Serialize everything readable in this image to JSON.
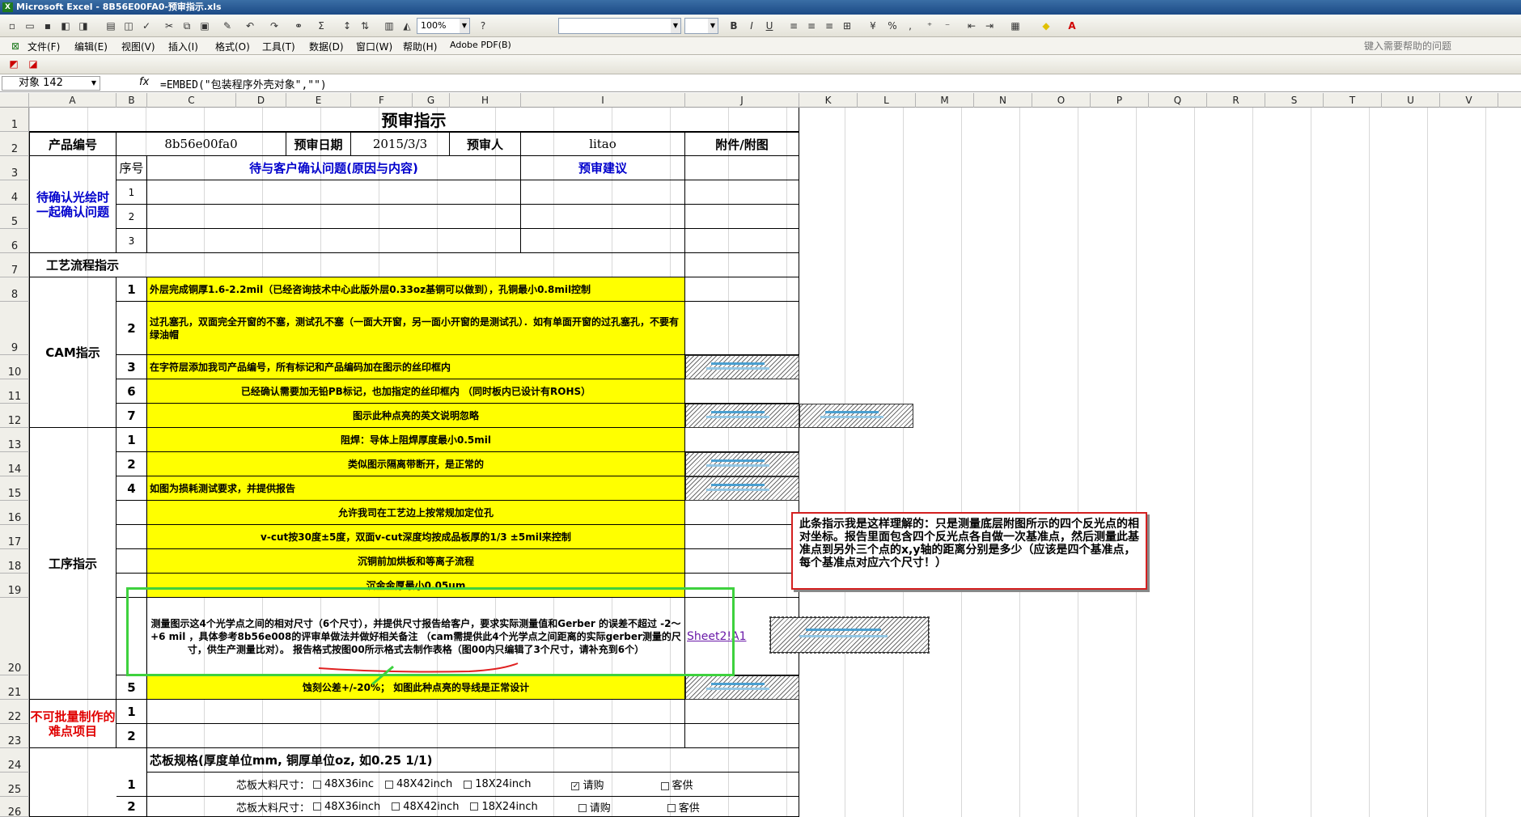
{
  "window": {
    "title": "Microsoft Excel - 8B56E00FA0-预审指示.xls"
  },
  "toolbar": {
    "zoom": "100%",
    "font_name": "",
    "font_size": ""
  },
  "menu": [
    "文件(F)",
    "编辑(E)",
    "视图(V)",
    "插入(I)",
    "格式(O)",
    "工具(T)",
    "数据(D)",
    "窗口(W)",
    "帮助(H)",
    "Adobe PDF(B)"
  ],
  "help_search": {
    "placeholder": "键入需要帮助的问题"
  },
  "formula_bar": {
    "name_box": "对象 142",
    "fx": "fx",
    "formula": "=EMBED(\"包装程序外壳对象\",\"\")"
  },
  "columns": [
    "A",
    "B",
    "C",
    "D",
    "E",
    "F",
    "G",
    "H",
    "I",
    "J",
    "K",
    "L",
    "M",
    "N",
    "O",
    "P",
    "Q",
    "R",
    "S",
    "T",
    "U",
    "V"
  ],
  "rows": [
    "1",
    "2",
    "3",
    "4",
    "5",
    "6",
    "7",
    "8",
    "9",
    "10",
    "11",
    "12",
    "13",
    "14",
    "15",
    "16",
    "17",
    "18",
    "19",
    "20",
    "21",
    "22",
    "23",
    "24",
    "25",
    "26"
  ],
  "sheet": {
    "title": "预审指示",
    "product_no_label": "产品编号",
    "product_no": "8b56e00fa0",
    "review_date_label": "预审日期",
    "review_date": "2015/3/3",
    "reviewer_label": "预审人",
    "reviewer": "litao",
    "attachment_label": "附件/附图",
    "confirm_section": "待确认光绘时一起确认问题",
    "seq_label": "序号",
    "issue_header": "待与客户确认问题(原因与内容)",
    "suggest_header": "预审建议",
    "confirm_rows": [
      "1",
      "2",
      "3"
    ],
    "process_label": "工艺流程指示",
    "cam_label": "CAM指示",
    "cam_items": [
      {
        "no": "1",
        "text": "外层完成铜厚1.6-2.2mil（已经咨询技术中心此版外层0.33oz基铜可以做到），孔铜最小0.8mil控制"
      },
      {
        "no": "2",
        "text": "过孔塞孔，双面完全开窗的不塞，测试孔不塞（一面大开窗，另一面小开窗的是测试孔）．如有单面开窗的过孔塞孔，不要有绿油帽"
      },
      {
        "no": "3",
        "text": "在字符层添加我司产品编号，所有标记和产品编码加在图示的丝印框内"
      },
      {
        "no": "6",
        "text": "已经确认需要加无铅PB标记，也加指定的丝印框内  （同时板内已设计有ROHS）"
      },
      {
        "no": "7",
        "text": "图示此种点亮的英文说明忽略"
      }
    ],
    "proc_label": "工序指示",
    "proc_items": [
      {
        "no": "1",
        "text": "阻焊：导体上阻焊厚度最小0.5mil"
      },
      {
        "no": "2",
        "text": "类似图示隔离带断开，是正常的"
      },
      {
        "no": "4",
        "text": "如图为损耗测试要求，并提供报告"
      },
      {
        "no": "",
        "text": "允许我司在工艺边上按常规加定位孔"
      },
      {
        "no": "",
        "text": "v-cut按30度±5度，双面v-cut深度均按成品板厚的1/3  ±5mil来控制"
      },
      {
        "no": "",
        "text": "沉铜前加烘板和等离子流程"
      },
      {
        "no": "",
        "text": "沉金金厚最小0.05um"
      },
      {
        "no": "",
        "text": "测量图示这4个光学点之间的相对尺寸（6个尺寸），并提供尺寸报告给客户，要求实际测量值和Gerber 的误差不超过  -2～+6 mil ，具体参考8b56e008的评审单做法并做好相关备注    （cam需提供此4个光学点之间距离的实际gerber测量的尺寸，供生产测量比对）。  报告格式按图00所示格式去制作表格（图00内只编辑了3个尺寸，请补充到6个）"
      },
      {
        "no": "5",
        "text": "蚀刻公差+/-20%；        如图此种点亮的导线是正常设计"
      }
    ],
    "link_text": "Sheet2!A1",
    "difficult_label": "不可批量制作的难点项目",
    "difficult_rows": [
      "1",
      "2"
    ],
    "core_spec": "芯板规格(厚度单位mm, 铜厚单位oz, 如0.25 1/1)",
    "core_rows": [
      {
        "no": "1",
        "label": "芯板大料尺寸：",
        "opts": [
          "48X36inc",
          "48X42inch",
          "18X24inch",
          "请购",
          "客供"
        ],
        "checked": 3
      },
      {
        "no": "2",
        "label": "芯板大料尺寸：",
        "opts": [
          "48X36inch",
          "48X42inch",
          "18X24inch",
          "请购",
          "客供"
        ],
        "checked": -1
      }
    ]
  },
  "comment": "此条指示我是这样理解的：只是测量底层附图所示的四个反光点的相对坐标。报告里面包含四个反光点各自做一次基准点，然后测量此基准点到另外三个点的x,y轴的距离分别是多少（应该是四个基准点，每个基准点对应六个尺寸！）"
}
